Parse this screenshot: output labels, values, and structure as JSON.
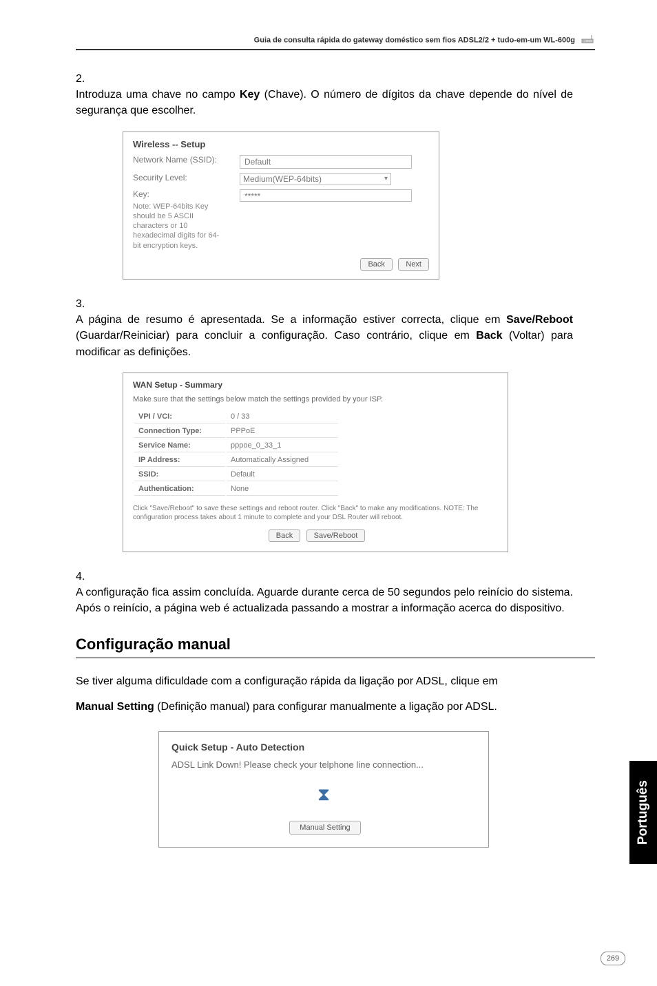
{
  "header": {
    "text": "Guia de consulta rápida do gateway doméstico sem fios ADSL2/2 + tudo-em-um WL-600g"
  },
  "step2": {
    "num": "2.",
    "textA": "Introduza uma chave no campo ",
    "bold1": "Key",
    "textB": " (Chave). O número de dígitos da chave depende do nível de segurança que escolher."
  },
  "ss1": {
    "title": "Wireless -- Setup",
    "row1_label": "Network Name (SSID):",
    "row1_value": "Default",
    "row2_label": "Security Level:",
    "row2_value": "Medium(WEP-64bits)",
    "row3_label": "Key:",
    "row3_value": "*****",
    "note": "Note: WEP-64bits Key should be 5 ASCII characters or 10 hexadecimal digits for 64-bit encryption keys.",
    "btn_back": "Back",
    "btn_next": "Next"
  },
  "step3": {
    "num": "3.",
    "textA": "A página de resumo é apresentada. Se a informação estiver correcta, clique em ",
    "bold1": "Save/Reboot",
    "textB": " (Guardar/Reiniciar) para concluir a configuração. Caso contrário, clique em ",
    "bold2": "Back",
    "textC": " (Voltar) para modificar as definições."
  },
  "ss2": {
    "title": "WAN Setup - Summary",
    "desc": "Make sure that the settings below match the settings provided by your ISP.",
    "rows": [
      {
        "k": "VPI / VCI:",
        "v": "0 / 33"
      },
      {
        "k": "Connection Type:",
        "v": "PPPoE"
      },
      {
        "k": "Service Name:",
        "v": "pppoe_0_33_1"
      },
      {
        "k": "IP Address:",
        "v": "Automatically Assigned"
      },
      {
        "k": "SSID:",
        "v": "Default"
      },
      {
        "k": "Authentication:",
        "v": "None"
      }
    ],
    "note": "Click \"Save/Reboot\" to save these settings and reboot router. Click \"Back\" to make any modifications. NOTE: The configuration process takes about 1 minute to complete and your DSL Router will reboot.",
    "btn_back": "Back",
    "btn_save": "Save/Reboot"
  },
  "step4": {
    "num": "4.",
    "text": "A configuração fica assim concluída. Aguarde durante cerca de 50 segundos pelo reinício do sistema. Após o reinício, a página web é actualizada passando a mostrar a informação acerca do dispositivo."
  },
  "section_title": "Configuração manual",
  "para1": "Se tiver alguma dificuldade com a configuração rápida da ligação por ADSL, clique em",
  "para2a": "Manual Setting",
  "para2b": " (Definição manual) para configurar manualmente a ligação por ADSL.",
  "ss3": {
    "title": "Quick Setup - Auto Detection",
    "msg": "ADSL Link Down! Please check your telphone line connection...",
    "btn": "Manual Setting"
  },
  "side_tab": "Português",
  "page_num": "269"
}
